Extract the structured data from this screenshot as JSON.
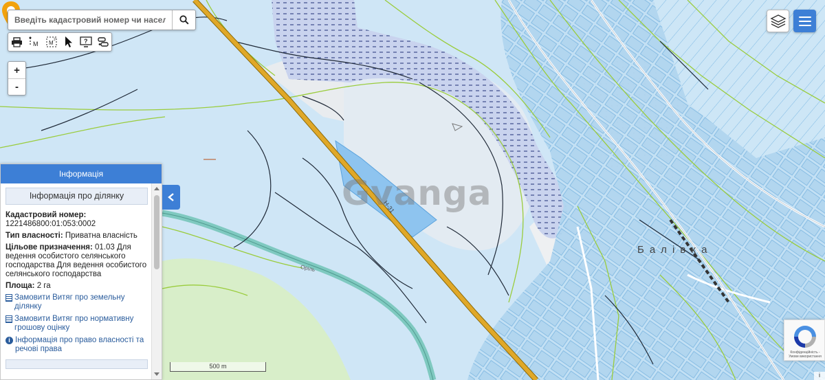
{
  "search": {
    "placeholder": "Введіть кадастровий номер чи населений"
  },
  "toolbar": {
    "tools": [
      "print-icon",
      "measure-distance-icon",
      "measure-area-icon",
      "pointer-icon",
      "help-icon",
      "route-icon"
    ]
  },
  "zoom": {
    "in_label": "+",
    "out_label": "-"
  },
  "panel": {
    "header": "Інформація",
    "section_title": "Інформація про ділянку",
    "cadastral_label": "Кадастровий номер:",
    "cadastral_value": "1221486800:01:053:0002",
    "ownership_label": "Тип власності:",
    "ownership_value": "Приватна власність",
    "purpose_label": "Цільове призначення:",
    "purpose_value": "01.03 Для ведення особистого селянського господарства Для ведення особистого селянського господарства",
    "area_label": "Площа:",
    "area_value": "2 га",
    "links": [
      "Замовити Витяг про земельну ділянку",
      "Замовити Витяг про нормативну грошову оцінку",
      "Інформація про право власності та речові права"
    ]
  },
  "map": {
    "place_name": "Балівка",
    "road_label": "Н-31",
    "river_label": "Оріль",
    "watermark": "Gvanga",
    "scale_label": "500 m",
    "attribution": "i"
  },
  "recaptcha": {
    "text": "Конфіденційність - Умови використання"
  },
  "colors": {
    "accent": "#3d7fd6",
    "parcel_fill": "#b8d9f2",
    "parcel_stroke": "#6aaee0",
    "green_line": "#9acc3c",
    "road": "#d4a017",
    "pin": "#f2a20c"
  }
}
